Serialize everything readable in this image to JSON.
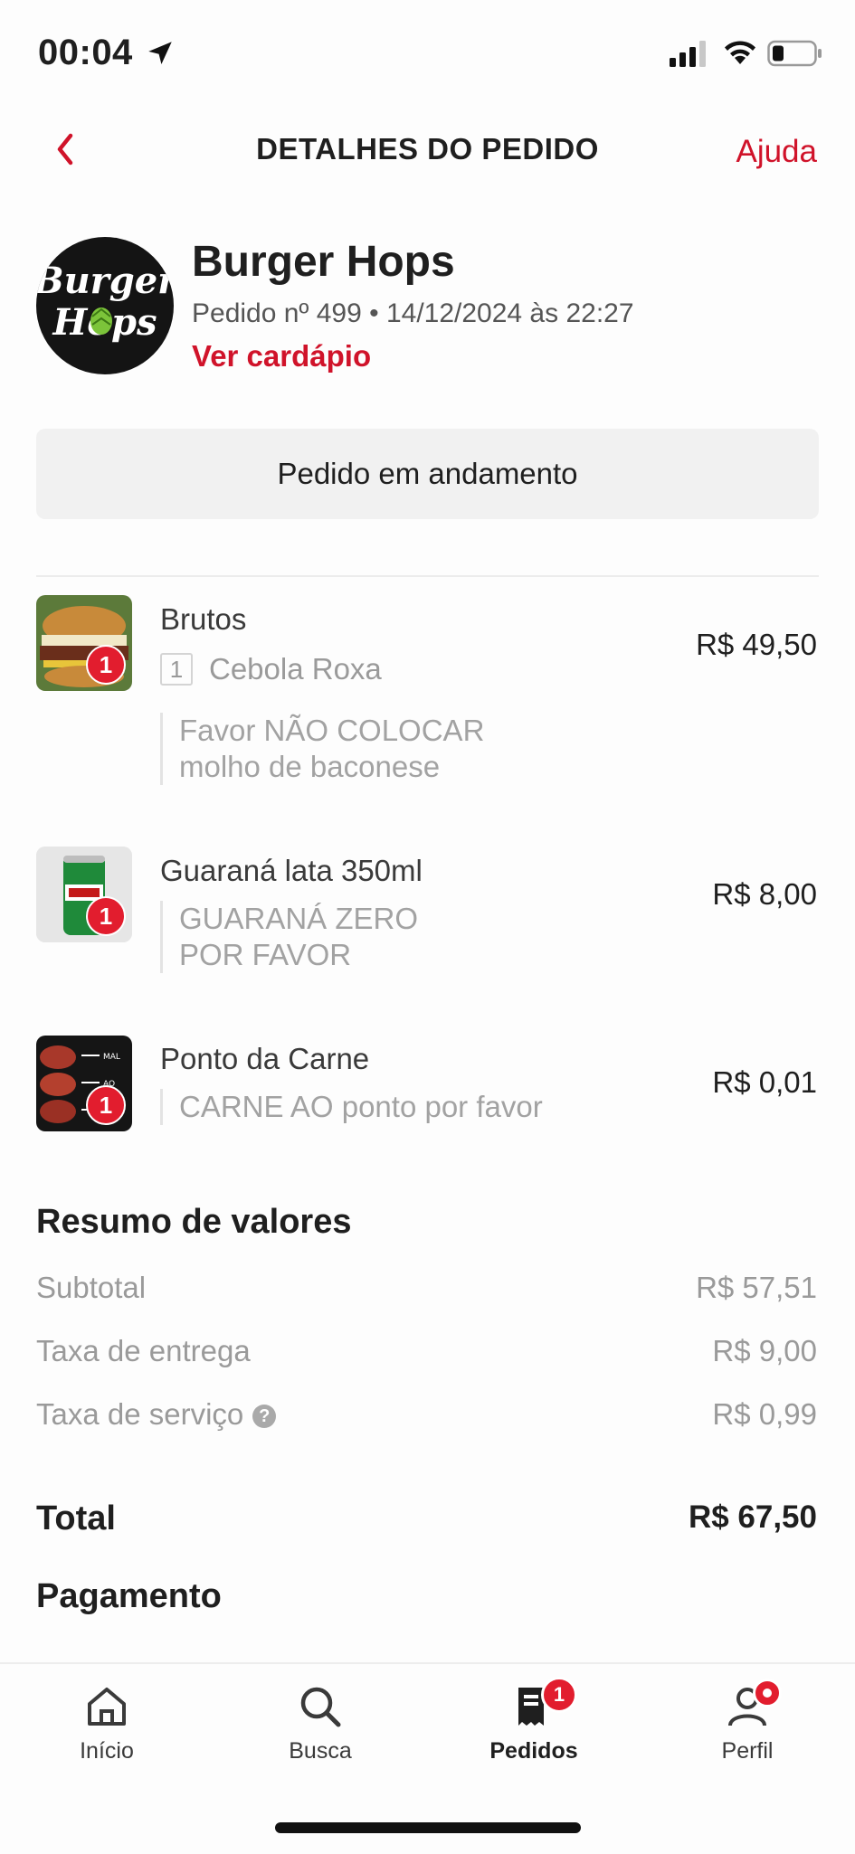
{
  "status_bar": {
    "time": "00:04"
  },
  "header": {
    "title": "DETALHES DO PEDIDO",
    "help_label": "Ajuda"
  },
  "store": {
    "logo_text_top": "Burger",
    "logo_text_bottom": "Hops",
    "name": "Burger Hops",
    "order_meta": "Pedido nº 499 • 14/12/2024 às 22:27",
    "menu_link": "Ver cardápio"
  },
  "order_status": "Pedido em andamento",
  "items": [
    {
      "name": "Brutos",
      "qty": "1",
      "price": "R$ 49,50",
      "addon": {
        "qty": "1",
        "name": "Cebola Roxa"
      },
      "note_line1": "Favor NÃO COLOCAR",
      "note_line2": "molho de baconese"
    },
    {
      "name": "Guaraná lata 350ml",
      "qty": "1",
      "price": "R$ 8,00",
      "note_line1": "GUARANÁ ZERO",
      "note_line2": "POR FAVOR"
    },
    {
      "name": "Ponto da Carne",
      "qty": "1",
      "price": "R$ 0,01",
      "note_line1": "CARNE AO ponto por favor"
    }
  ],
  "summary": {
    "title": "Resumo de valores",
    "subtotal_label": "Subtotal",
    "subtotal_value": "R$ 57,51",
    "delivery_label": "Taxa de entrega",
    "delivery_value": "R$ 9,00",
    "service_label": "Taxa de serviço",
    "service_value": "R$ 0,99",
    "total_label": "Total",
    "total_value": "R$ 67,50"
  },
  "payment": {
    "title": "Pagamento"
  },
  "tabbar": {
    "home": "Início",
    "search": "Busca",
    "orders": "Pedidos",
    "profile": "Perfil",
    "orders_badge": "1"
  },
  "colors": {
    "accent": "#d0132a",
    "badge": "#e21d2e"
  }
}
